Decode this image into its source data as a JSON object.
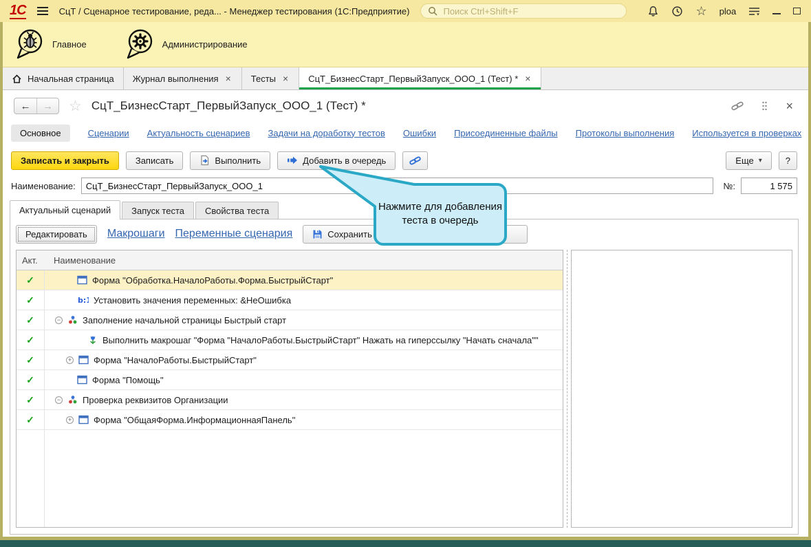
{
  "window": {
    "title": "СцТ / Сценарное тестирование, реда...   - Менеджер тестирования (1С:Предприятие)",
    "logo": "1С",
    "search_placeholder": "Поиск Ctrl+Shift+F",
    "user": "ploa"
  },
  "ribbon": {
    "items": [
      {
        "label": "Главное",
        "icon": "bug-icon"
      },
      {
        "label": "Администрирование",
        "icon": "gear-icon"
      }
    ]
  },
  "tabbar": {
    "tabs": [
      {
        "label": "Начальная страница",
        "icon": "home",
        "closable": false,
        "active": false
      },
      {
        "label": "Журнал выполнения",
        "closable": true,
        "active": false
      },
      {
        "label": "Тесты",
        "closable": true,
        "active": false
      },
      {
        "label": "СцТ_БизнесСтарт_ПервыйЗапуск_ООО_1 (Тест) *",
        "closable": true,
        "active": true
      }
    ]
  },
  "form": {
    "title": "СцТ_БизнесСтарт_ПервыйЗапуск_ООО_1 (Тест) *",
    "nav_links": [
      {
        "label": "Основное",
        "active": true
      },
      {
        "label": "Сценарии"
      },
      {
        "label": "Актуальность сценариев"
      },
      {
        "label": "Задачи на доработку тестов"
      },
      {
        "label": "Ошибки"
      },
      {
        "label": "Присоединенные файлы"
      },
      {
        "label": "Протоколы выполнения"
      },
      {
        "label": "Используется в проверках"
      }
    ],
    "toolbar": {
      "save_and_close": "Записать и закрыть",
      "save": "Записать",
      "run": "Выполнить",
      "add_to_queue": "Добавить в очередь",
      "more": "Еще",
      "help": "?"
    },
    "fields": {
      "name_label": "Наименование:",
      "name_value": "СцТ_БизнесСтарт_ПервыйЗапуск_ООО_1",
      "number_label": "№:",
      "number_value": "1 575"
    },
    "subtabs": [
      {
        "label": "Актуальный сценарий",
        "active": true
      },
      {
        "label": "Запуск теста",
        "active": false
      },
      {
        "label": "Свойства теста",
        "active": false
      }
    ],
    "scenario_toolbar": {
      "edit": "Редактировать",
      "macro_steps": "Макрошаги",
      "scenario_variables": "Переменные сценария",
      "save_to_file": "Сохранить в файл"
    },
    "tooltip": "Нажмите для добавления теста в очередь",
    "table": {
      "columns": [
        "Акт.",
        "Наименование"
      ],
      "rows": [
        {
          "checked": true,
          "selected": true,
          "icon": "form-icon",
          "indent": 1,
          "expander": null,
          "text": "Форма \"Обработка.НачалоРаботы.Форма.БыстрыйСтарт\""
        },
        {
          "checked": true,
          "selected": false,
          "icon": "variables-icon",
          "indent": 1,
          "expander": null,
          "text": "Установить значения переменных: &НеОшибка"
        },
        {
          "checked": true,
          "selected": false,
          "icon": "scenario-group-icon",
          "indent": 0,
          "expander": "minus",
          "text": "Заполнение начальной страницы Быстрый старт"
        },
        {
          "checked": true,
          "selected": false,
          "icon": "macro-step-icon",
          "indent": 2,
          "expander": null,
          "text": "Выполнить макрошаг \"Форма \"НачалоРаботы.БыстрыйСтарт\" Нажать на гиперссылку \"Начать сначала\"\""
        },
        {
          "checked": true,
          "selected": false,
          "icon": "form-icon",
          "indent": 1,
          "expander": "plus",
          "text": "Форма \"НачалоРаботы.БыстрыйСтарт\""
        },
        {
          "checked": true,
          "selected": false,
          "icon": "form-icon",
          "indent": 1,
          "expander": null,
          "text": "Форма \"Помощь\""
        },
        {
          "checked": true,
          "selected": false,
          "icon": "scenario-group-icon",
          "indent": 0,
          "expander": "minus",
          "text": "Проверка реквизитов Организации"
        },
        {
          "checked": true,
          "selected": false,
          "icon": "form-icon",
          "indent": 1,
          "expander": "plus",
          "text": "Форма \"ОбщаяФорма.ИнформационнаяПанель\""
        }
      ]
    }
  },
  "colors": {
    "titlebar_bg": "#f6e8a0",
    "ribbon_bg": "#fbf3b6",
    "active_tab_underline": "#18a348",
    "link": "#3566b0",
    "accent_yellow_button": "#ffd70f",
    "selected_row_bg": "#fcf2c6",
    "check_green": "#18a318",
    "tooltip_border": "#2ba8c6",
    "tooltip_bg": "#cdeef8",
    "window_frame": "#b6b063",
    "bottom_bar": "#275d58"
  }
}
